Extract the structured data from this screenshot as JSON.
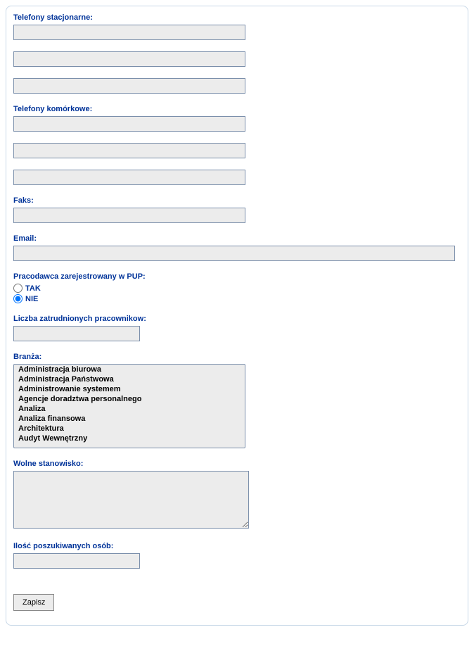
{
  "labels": {
    "landline_phones": "Telefony stacjonarne:",
    "mobile_phones": "Telefony komórkowe:",
    "fax": "Faks:",
    "email": "Email:",
    "employer_registered": "Pracodawca zarejestrowany w PUP:",
    "yes": "TAK",
    "no": "NIE",
    "employee_count": "Liczba zatrudnionych pracownikow:",
    "industry": "Branża:",
    "vacancy": "Wolne stanowisko:",
    "positions_count": "Ilość poszukiwanych osób:"
  },
  "values": {
    "landline1": "",
    "landline2": "",
    "landline3": "",
    "mobile1": "",
    "mobile2": "",
    "mobile3": "",
    "fax": "",
    "email": "",
    "employer_registered": "NIE",
    "employee_count": "",
    "vacancy": "",
    "positions_count": ""
  },
  "industry_options": [
    "Administracja biurowa",
    "Administracja Państwowa",
    "Administrowanie systemem",
    "Agencje doradztwa personalnego",
    "Analiza",
    "Analiza finansowa",
    "Architektura",
    "Audyt Wewnętrzny"
  ],
  "buttons": {
    "save": "Zapisz"
  }
}
